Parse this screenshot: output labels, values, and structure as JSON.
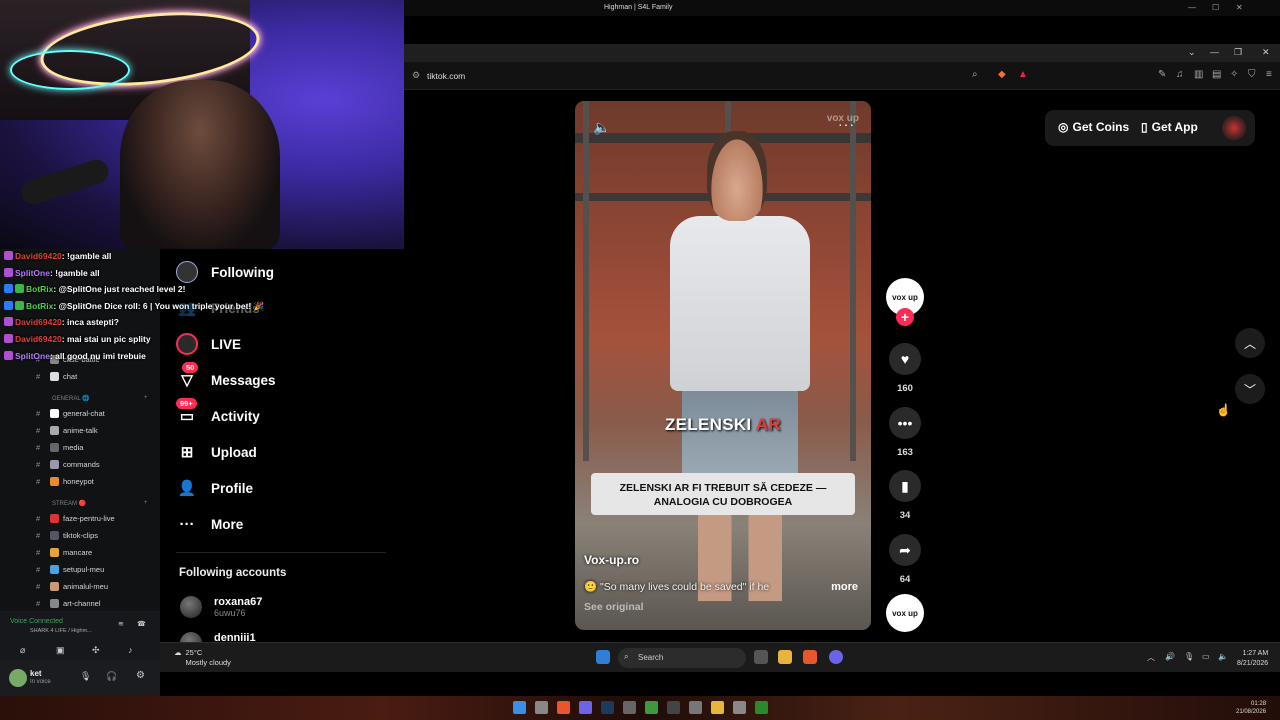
{
  "os": {
    "window_title": "Highman | S4L Family"
  },
  "chat": [
    {
      "user": "David69420",
      "msg": "!gamble all",
      "color": "#e0413a",
      "ico": "#b14fd3"
    },
    {
      "user": "SplitOne",
      "msg": "!gamble all",
      "color": "#b57bff",
      "ico": "#b14fd3"
    },
    {
      "user": "BotRix",
      "msg": "@SplitOne just reached level 2!",
      "color": "#4fd14f",
      "ico": "#2a7cff"
    },
    {
      "user": "BotRix",
      "msg": "@SplitOne Dice roll: 6 | You won triple your bet! 🎉",
      "color": "#4fd14f",
      "ico": "#2a7cff"
    },
    {
      "user": "David69420",
      "msg": "inca astepti?",
      "color": "#e0413a",
      "ico": "#b14fd3"
    },
    {
      "user": "David69420",
      "msg": "mai stai un pic splity",
      "color": "#e0413a",
      "ico": "#b14fd3"
    },
    {
      "user": "SplitOne",
      "msg": "all good nu imi trebuie",
      "color": "#b57bff",
      "ico": "#b14fd3"
    }
  ],
  "discord": {
    "top_channels": [
      "case-battle",
      "chat"
    ],
    "cat_general": "GENERAL",
    "general_channels": [
      "general-chat",
      "anime-talk",
      "media",
      "commands",
      "honeypot"
    ],
    "cat_stream": "STREAM",
    "stream_channels": [
      "faze-pentru-live",
      "tiktok-clips",
      "mancare",
      "setupul-meu",
      "animalul-meu",
      "art-channel"
    ],
    "voice_status": "Voice Connected",
    "voice_channel": "SHARK 4 LIFE / Highm...",
    "user_name": "ket",
    "user_status": "In voice"
  },
  "browser": {
    "url": "tiktok.com"
  },
  "tiktok": {
    "nav": {
      "following": "Following",
      "friends": "Friends",
      "live": "LIVE",
      "messages": "Messages",
      "messages_badge": "50",
      "activity": "Activity",
      "activity_badge": "99+",
      "upload": "Upload",
      "profile": "Profile",
      "more": "More"
    },
    "following_accounts_title": "Following accounts",
    "accounts": [
      {
        "name": "roxana67",
        "handle": "6uwu76"
      },
      {
        "name": "denniii1",
        "handle": ""
      }
    ],
    "get_coins": "Get Coins",
    "get_app": "Get App",
    "video": {
      "overlay_white": "ZELENSKI",
      "overlay_red": "AR",
      "caption_line1": "ZELENSKI AR FI TREBUIT SĂ CEDEZE —",
      "caption_line2": "ANALOGIA CU DOBROGEA",
      "author": "Vox-up.ro",
      "description": "\"So many lives could be saved\" if he",
      "more": "more",
      "see_original": "See original",
      "creator_logo": "vox up"
    },
    "counts": {
      "likes": "160",
      "comments": "163",
      "saves": "34",
      "shares": "64"
    }
  },
  "taskbar_inner": {
    "temp": "25°C",
    "weather": "Mostly cloudy",
    "search": "Search",
    "time": "1:27 AM",
    "date": "8/21/2026"
  },
  "taskbar_outer": {
    "time": "01:28",
    "date": "21/08/2026"
  }
}
